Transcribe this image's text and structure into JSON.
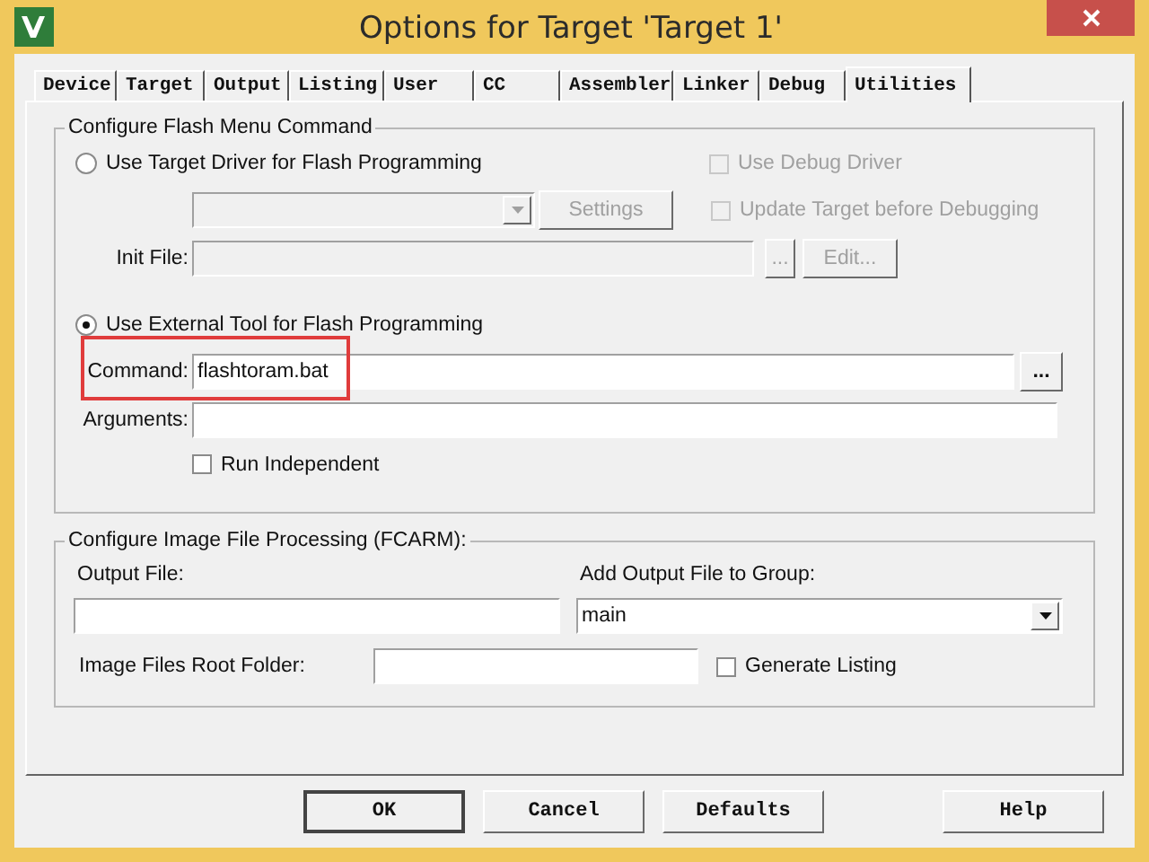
{
  "window": {
    "title": "Options for Target 'Target 1'"
  },
  "tabs": [
    {
      "label": "Device",
      "selected": false
    },
    {
      "label": "Target",
      "selected": false
    },
    {
      "label": "Output",
      "selected": false
    },
    {
      "label": "Listing",
      "selected": false
    },
    {
      "label": "User",
      "selected": false
    },
    {
      "label": "CC",
      "selected": false
    },
    {
      "label": "Assembler",
      "selected": false
    },
    {
      "label": "Linker",
      "selected": false
    },
    {
      "label": "Debug",
      "selected": false
    },
    {
      "label": "Utilities",
      "selected": true
    }
  ],
  "flash_group": {
    "title": "Configure Flash Menu Command",
    "target_driver": {
      "label": "Use Target Driver for Flash Programming",
      "selected": false
    },
    "driver_select": {
      "disabled": true
    },
    "settings_button": {
      "label": "Settings",
      "disabled": true
    },
    "use_debug_driver": {
      "label": "Use Debug Driver",
      "checked": false,
      "disabled": true
    },
    "update_target": {
      "label": "Update Target before Debugging",
      "checked": false,
      "disabled": true
    },
    "init_file": {
      "label": "Init File:",
      "disabled": true
    },
    "init_browse_button": {
      "label": "...",
      "disabled": true
    },
    "edit_button": {
      "label": "Edit...",
      "disabled": true
    },
    "external_tool": {
      "label": "Use External Tool for Flash Programming",
      "selected": true
    },
    "command": {
      "label": "Command:",
      "value": "flashtoram.bat"
    },
    "command_browse_button": {
      "label": "...",
      "disabled": false
    },
    "arguments": {
      "label": "Arguments:"
    },
    "run_independent": {
      "label": "Run Independent",
      "checked": false,
      "disabled": false
    }
  },
  "image_group": {
    "title": "Configure Image File Processing (FCARM):",
    "output_file": {
      "label": "Output File:"
    },
    "add_to_group": {
      "label": "Add Output File  to Group:",
      "value": "main"
    },
    "root_folder": {
      "label": "Image Files Root Folder:"
    },
    "generate_listing": {
      "label": "Generate Listing",
      "checked": false,
      "disabled": false
    }
  },
  "buttons": [
    {
      "label": "OK",
      "default": true
    },
    {
      "label": "Cancel",
      "default": false
    },
    {
      "label": "Defaults",
      "default": false
    },
    {
      "label": "Help",
      "default": false
    }
  ]
}
